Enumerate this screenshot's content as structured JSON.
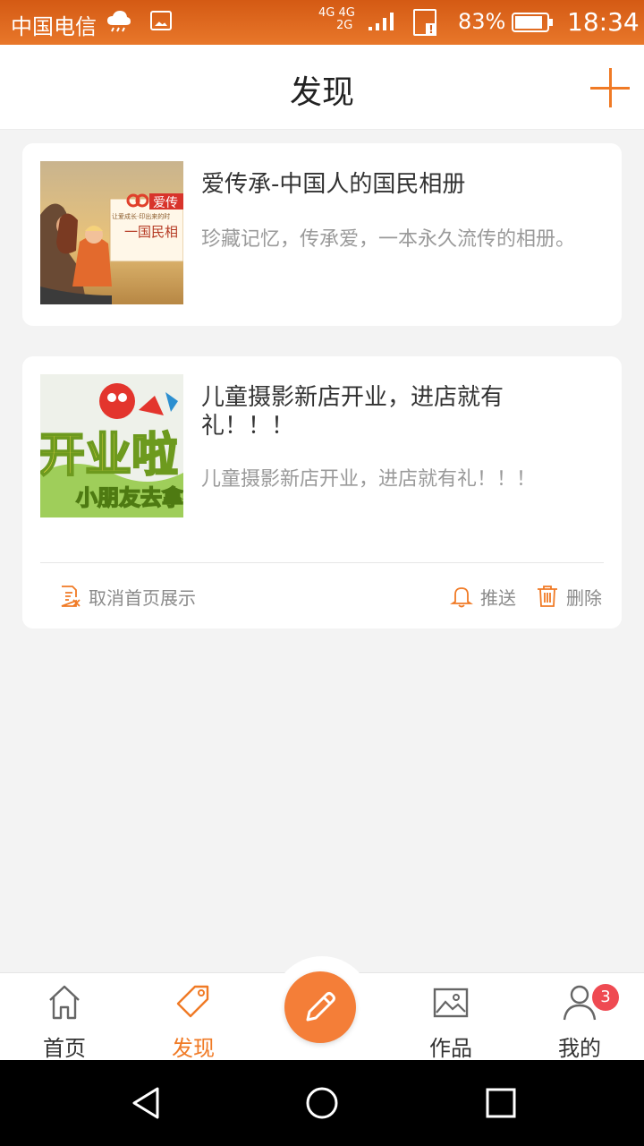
{
  "status_bar": {
    "carrier": "中国电信",
    "network_top": "4G 4G",
    "network_bottom": "2G",
    "battery": "83%",
    "time": "18:34"
  },
  "header": {
    "title": "发现",
    "add_icon": "plus-icon"
  },
  "cards": [
    {
      "title": "爱传承-中国人的国民相册",
      "description": "珍藏记忆，传承爱，一本永久流传的相册。",
      "thumb_text_brand": "爱传",
      "thumb_text_line": "一国民相",
      "thumb_small": "让爱成长·印出来的时"
    },
    {
      "title": "儿童摄影新店开业，进店就有礼！！！",
      "description": "儿童摄影新店开业，进店就有礼！！！",
      "thumb_text_main": "开业啦",
      "thumb_text_sub": "小朋友去拿礼",
      "actions": {
        "cancel_home": "取消首页展示",
        "push": "推送",
        "delete": "删除"
      }
    }
  ],
  "bottom_nav": {
    "items": [
      {
        "label": "首页",
        "icon": "home-icon"
      },
      {
        "label": "发现",
        "icon": "tag-icon",
        "active": true
      },
      {
        "label": "作品",
        "icon": "image-icon"
      },
      {
        "label": "我的",
        "icon": "user-icon",
        "badge": "3"
      }
    ],
    "compose_icon": "pencil-icon"
  },
  "colors": {
    "accent": "#f07a25",
    "badge": "#ef4a52"
  }
}
